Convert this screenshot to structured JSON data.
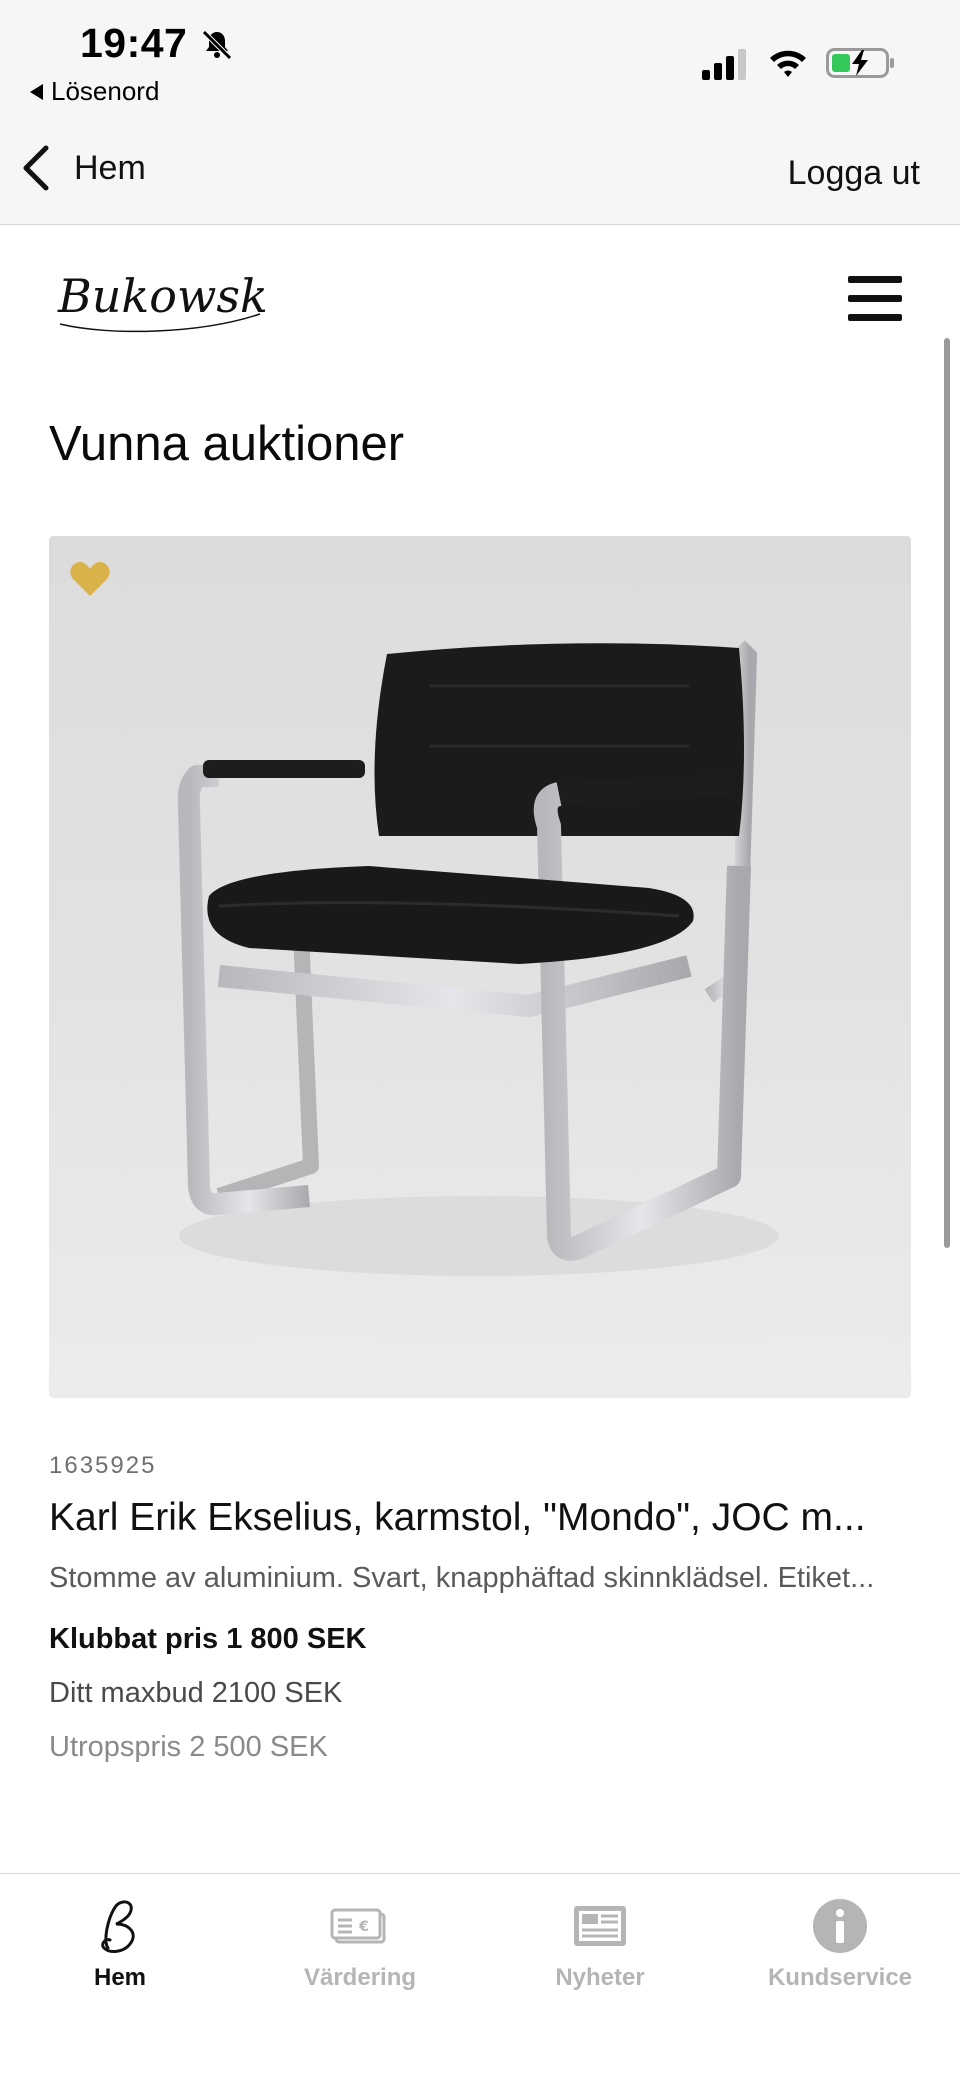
{
  "status_bar": {
    "time": "19:47",
    "back_app_label": "Lösenord"
  },
  "nav": {
    "back_label": "Hem",
    "logout_label": "Logga ut"
  },
  "site": {
    "logo_text": "Bukowskis"
  },
  "page": {
    "title": "Vunna auktioner"
  },
  "item": {
    "lot_number": "1635925",
    "title": "Karl Erik Ekselius, karmstol, \"Mondo\", JOC m...",
    "description": "Stomme av aluminium. Svart, knapphäftad skinnklädsel. Etiket...",
    "hammer_price": "Klubbat pris 1 800 SEK",
    "max_bid": "Ditt maxbud 2100 SEK",
    "estimate": "Utropspris 2 500 SEK",
    "favorite_color": "#d9b34a"
  },
  "tabs": [
    {
      "label": "Hem",
      "icon": "bukowskis-b-icon",
      "active": true
    },
    {
      "label": "Värdering",
      "icon": "valuation-icon",
      "active": false
    },
    {
      "label": "Nyheter",
      "icon": "newspaper-icon",
      "active": false
    },
    {
      "label": "Kundservice",
      "icon": "info-icon",
      "active": false
    }
  ]
}
